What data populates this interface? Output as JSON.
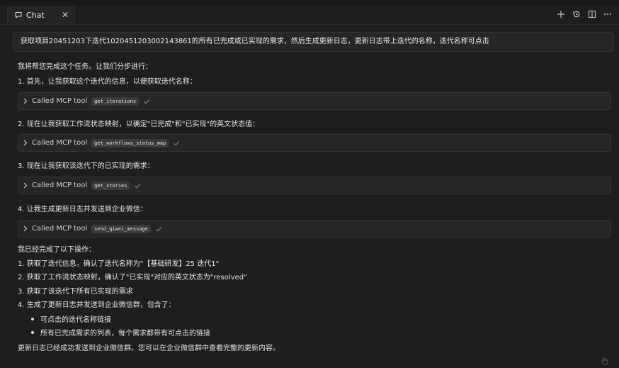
{
  "tab": {
    "label": "Chat",
    "close": "✕"
  },
  "prompt": "获取项目20451203下迭代1020451203002143861的所有已完成或已实现的需求，然后生成更新日志，更新日志带上迭代的名称，迭代名称可点击",
  "intro": "我将帮您完成这个任务。让我们分步进行：",
  "steps": [
    {
      "text": "1. 首先，让我获取这个迭代的信息，以便获取迭代名称：",
      "called": "Called MCP tool",
      "tool": "get_iterations"
    },
    {
      "text": "2. 现在让我获取工作流状态映射，以确定\"已完成\"和\"已实现\"的英文状态值：",
      "called": "Called MCP tool",
      "tool": "get_workflows_status_map"
    },
    {
      "text": "3. 现在让我获取该迭代下的已实现的需求：",
      "called": "Called MCP tool",
      "tool": "get_stories"
    },
    {
      "text": "4. 让我生成更新日志并发送到企业微信：",
      "called": "Called MCP tool",
      "tool": "send_qiwei_message"
    }
  ],
  "summary": {
    "heading": "我已经完成了以下操作：",
    "items": [
      "1. 获取了迭代信息，确认了迭代名称为\"【基础研发】25 迭代1\"",
      "2. 获取了工作流状态映射，确认了\"已实现\"对应的英文状态为\"resolved\"",
      "3. 获取了该迭代下所有已实现的需求",
      "4. 生成了更新日志并发送到企业微信群，包含了："
    ],
    "bullets": [
      "可点击的迭代名称链接",
      "所有已完成需求的列表，每个需求都带有可点击的链接"
    ],
    "footer": "更新日志已经成功发送到企业微信群。您可以在企业微信群中查看完整的更新内容。"
  }
}
